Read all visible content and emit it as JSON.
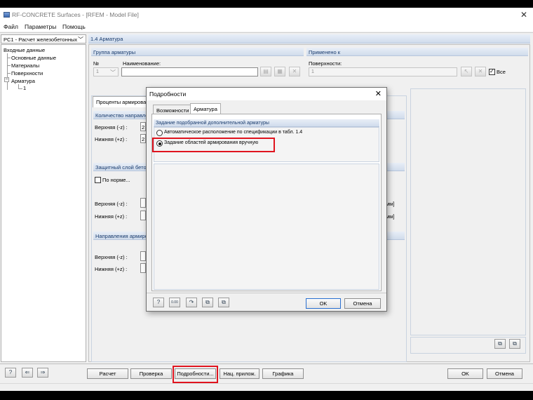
{
  "window": {
    "title": "RF-CONCRETE Surfaces - [RFEM - Model File]"
  },
  "menu": [
    "Файл",
    "Параметры",
    "Помощь"
  ],
  "case_selector": {
    "value": "PC1 - Расчет железобетонных"
  },
  "panel_title": "1.4 Арматура",
  "tree": {
    "root": "Входные данные",
    "items": [
      "Основные данные",
      "Материалы",
      "Поверхности",
      "Арматура"
    ],
    "sub": "1"
  },
  "group": {
    "header": "Группа арматуры",
    "no_label": "№",
    "no_value": "1",
    "name_label": "Наименование:",
    "name_value": ""
  },
  "applied": {
    "header": "Применено к",
    "surfaces_label": "Поверхности:",
    "surfaces_value": "1",
    "all_label": "Все"
  },
  "bg_form": {
    "tab_label": "Проценты армирован",
    "count_header": "Количество направле",
    "upper_label": "Верхняя (-z) :",
    "lower_label": "Нижняя (+z) :",
    "upper_value": "2",
    "lower_value": "2",
    "cover_header": "Защитный слой бето",
    "norm_label": "По норме...",
    "upper2_label": "Верхняя (-z) :",
    "lower2_label": "Нижняя (+z) :",
    "unit_upper": "мм]",
    "unit_lower": "мм]",
    "dir_header": "Направления армиро",
    "upper3_label": "Верхняя (-z) :",
    "lower3_label": "Нижняя (+z) :"
  },
  "dialog": {
    "title": "Подробности",
    "tabs": [
      "Возможности",
      "Арматура"
    ],
    "group_header": "Задание подобранной дополнительной арматуры",
    "option1": "Автоматическое расположение по спецификации в табл. 1.4",
    "option2": "Задание областей армирования вручную",
    "selected": 2,
    "ok": "OK",
    "cancel": "Отмена",
    "value_icon_text": "0.00"
  },
  "bottom": {
    "calc": "Расчет",
    "check": "Проверка",
    "details": "Подробности...",
    "national_annex": "Нац. прилож.",
    "graphics": "Графика",
    "ok": "OK",
    "cancel": "Отмена"
  },
  "colors": {
    "highlight": "#e0141e",
    "section_header": "#1a3c6e"
  }
}
